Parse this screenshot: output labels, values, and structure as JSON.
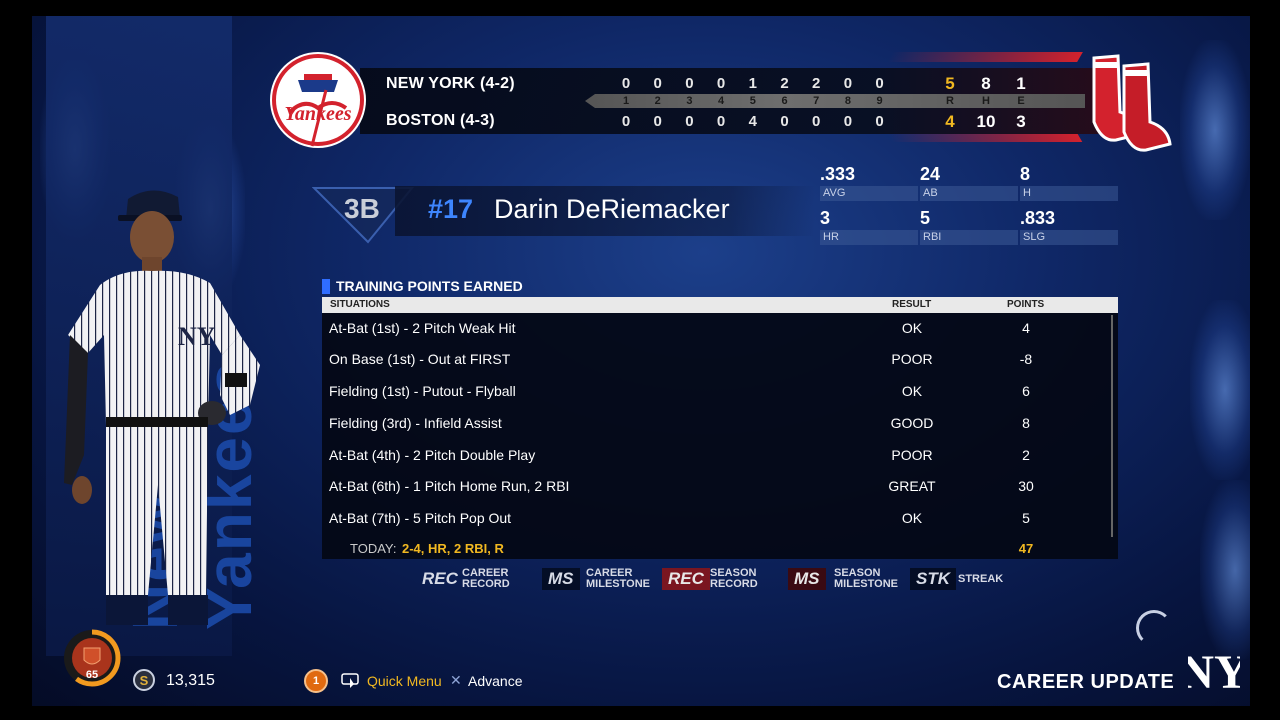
{
  "scoreboard": {
    "away": {
      "name": "NEW YORK (4-2)",
      "innings": [
        "0",
        "0",
        "0",
        "0",
        "1",
        "2",
        "2",
        "0",
        "0"
      ],
      "R": "5",
      "H": "8",
      "E": "1"
    },
    "home": {
      "name": "BOSTON (4-3)",
      "innings": [
        "0",
        "0",
        "0",
        "0",
        "4",
        "0",
        "0",
        "0",
        "0"
      ],
      "R": "4",
      "H": "10",
      "E": "3"
    },
    "inning_labels": [
      "1",
      "2",
      "3",
      "4",
      "5",
      "6",
      "7",
      "8",
      "9"
    ],
    "rhe_labels": [
      "R",
      "H",
      "E"
    ],
    "away_logo": "yankees-logo",
    "home_logo": "red-sox-logo",
    "colors": {
      "winner_runs": "#f1b821"
    }
  },
  "player": {
    "position": "3B",
    "number": "#17",
    "name": "Darin DeRiemacker"
  },
  "stats": [
    {
      "value": ".333",
      "label": "AVG"
    },
    {
      "value": "24",
      "label": "AB"
    },
    {
      "value": "8",
      "label": "H"
    },
    {
      "value": "3",
      "label": "HR"
    },
    {
      "value": "5",
      "label": "RBI"
    },
    {
      "value": ".833",
      "label": "SLG"
    }
  ],
  "training": {
    "title": "TRAINING POINTS EARNED",
    "headers": {
      "situations": "SITUATIONS",
      "result": "RESULT",
      "points": "POINTS"
    },
    "rows": [
      {
        "situation": "At-Bat (1st) - 2 Pitch Weak Hit",
        "result": "OK",
        "points": "4"
      },
      {
        "situation": "On Base (1st) - Out at FIRST",
        "result": "POOR",
        "points": "-8"
      },
      {
        "situation": "Fielding (1st) - Putout - Flyball",
        "result": "OK",
        "points": "6"
      },
      {
        "situation": "Fielding (3rd) - Infield Assist",
        "result": "GOOD",
        "points": "8"
      },
      {
        "situation": "At-Bat (4th) - 2 Pitch Double Play",
        "result": "POOR",
        "points": "2"
      },
      {
        "situation": "At-Bat (6th) - 1 Pitch Home Run, 2 RBI",
        "result": "GREAT",
        "points": "30"
      },
      {
        "situation": "At-Bat (7th) - 5 Pitch Pop Out",
        "result": "OK",
        "points": "5"
      }
    ],
    "today_label": "TODAY:",
    "today_line": "2-4,  HR,  2 RBI,  R",
    "today_total": "47"
  },
  "legend": [
    {
      "tag": "REC",
      "line1": "CAREER",
      "line2": "RECORD",
      "tag_color": "#d7dbe6",
      "bg": "rgba(0,0,0,0)"
    },
    {
      "tag": "MS",
      "line1": "CAREER",
      "line2": "MILESTONE",
      "tag_color": "#d7dbe6",
      "bg": "rgba(0,0,0,0.55)"
    },
    {
      "tag": "REC",
      "line1": "SEASON",
      "line2": "RECORD",
      "tag_color": "#e8e8e8",
      "bg": "#7a1620"
    },
    {
      "tag": "MS",
      "line1": "SEASON",
      "line2": "MILESTONE",
      "tag_color": "#e8e8e8",
      "bg": "#3a0a12"
    },
    {
      "tag": "STK",
      "line1": "STREAK",
      "line2": "",
      "tag_color": "#d7dbe6",
      "bg": "rgba(0,0,0,0.55)"
    }
  ],
  "footer": {
    "level": "65",
    "level_progress": 0.6,
    "coins": "13,315",
    "menu_button": "1",
    "quick_menu": "Quick Menu",
    "advance": "Advance",
    "screen_title": "CAREER UPDATE",
    "team_logo": "ny-logo"
  },
  "background_text": "New York Yankees"
}
